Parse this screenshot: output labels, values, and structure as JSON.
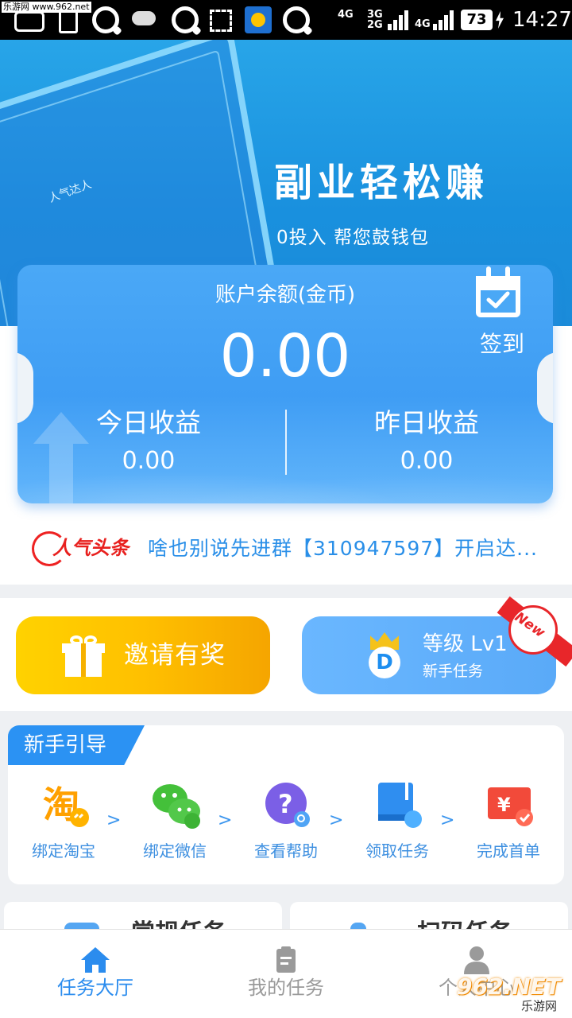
{
  "status_bar": {
    "watermark": "乐游网 www.962.net",
    "net1": "4G",
    "net2": "3G",
    "net3": "2G",
    "net4": "4G",
    "battery": "73",
    "time": "14:27"
  },
  "banner": {
    "title": "副业轻松赚",
    "subtitle": "0投入  帮您鼓钱包",
    "tablet_brand": "人气达人"
  },
  "account": {
    "balance_label": "账户余额(金币)",
    "balance_value": "0.00",
    "checkin_label": "签到",
    "today_label": "今日收益",
    "today_value": "0.00",
    "yesterday_label": "昨日收益",
    "yesterday_value": "0.00"
  },
  "news": {
    "logo_text": "人气头条",
    "text": "啥也别说先进群【310947597】开启达..."
  },
  "promo": {
    "invite_label": "邀请有奖",
    "level_title": "等级 Lv1",
    "level_subtitle": "新手任务",
    "level_badge_letter": "D",
    "ribbon_text": "New"
  },
  "guide": {
    "title": "新手引导",
    "steps": [
      {
        "label": "绑定淘宝",
        "icon": "taobao-icon"
      },
      {
        "label": "绑定微信",
        "icon": "wechat-icon"
      },
      {
        "label": "查看帮助",
        "icon": "help-icon"
      },
      {
        "label": "领取任务",
        "icon": "book-icon"
      },
      {
        "label": "完成首单",
        "icon": "ticket-icon"
      }
    ],
    "arrow": ">"
  },
  "task_cards": [
    {
      "label": "常规任务"
    },
    {
      "label": "扫码任务"
    }
  ],
  "bottom_nav": {
    "items": [
      {
        "label": "任务大厅",
        "icon": "home-icon",
        "active": true
      },
      {
        "label": "我的任务",
        "icon": "clipboard-icon",
        "active": false
      },
      {
        "label": "个人中心",
        "icon": "user-icon",
        "active": false
      }
    ]
  },
  "colors": {
    "primary": "#2b92f3",
    "nav_active": "#2b8cee",
    "nav_inactive": "#999999",
    "news_red": "#e8201e",
    "invite_yellow": "#ffc000"
  },
  "watermark": {
    "main": "962.NET",
    "sub": "乐游网"
  }
}
